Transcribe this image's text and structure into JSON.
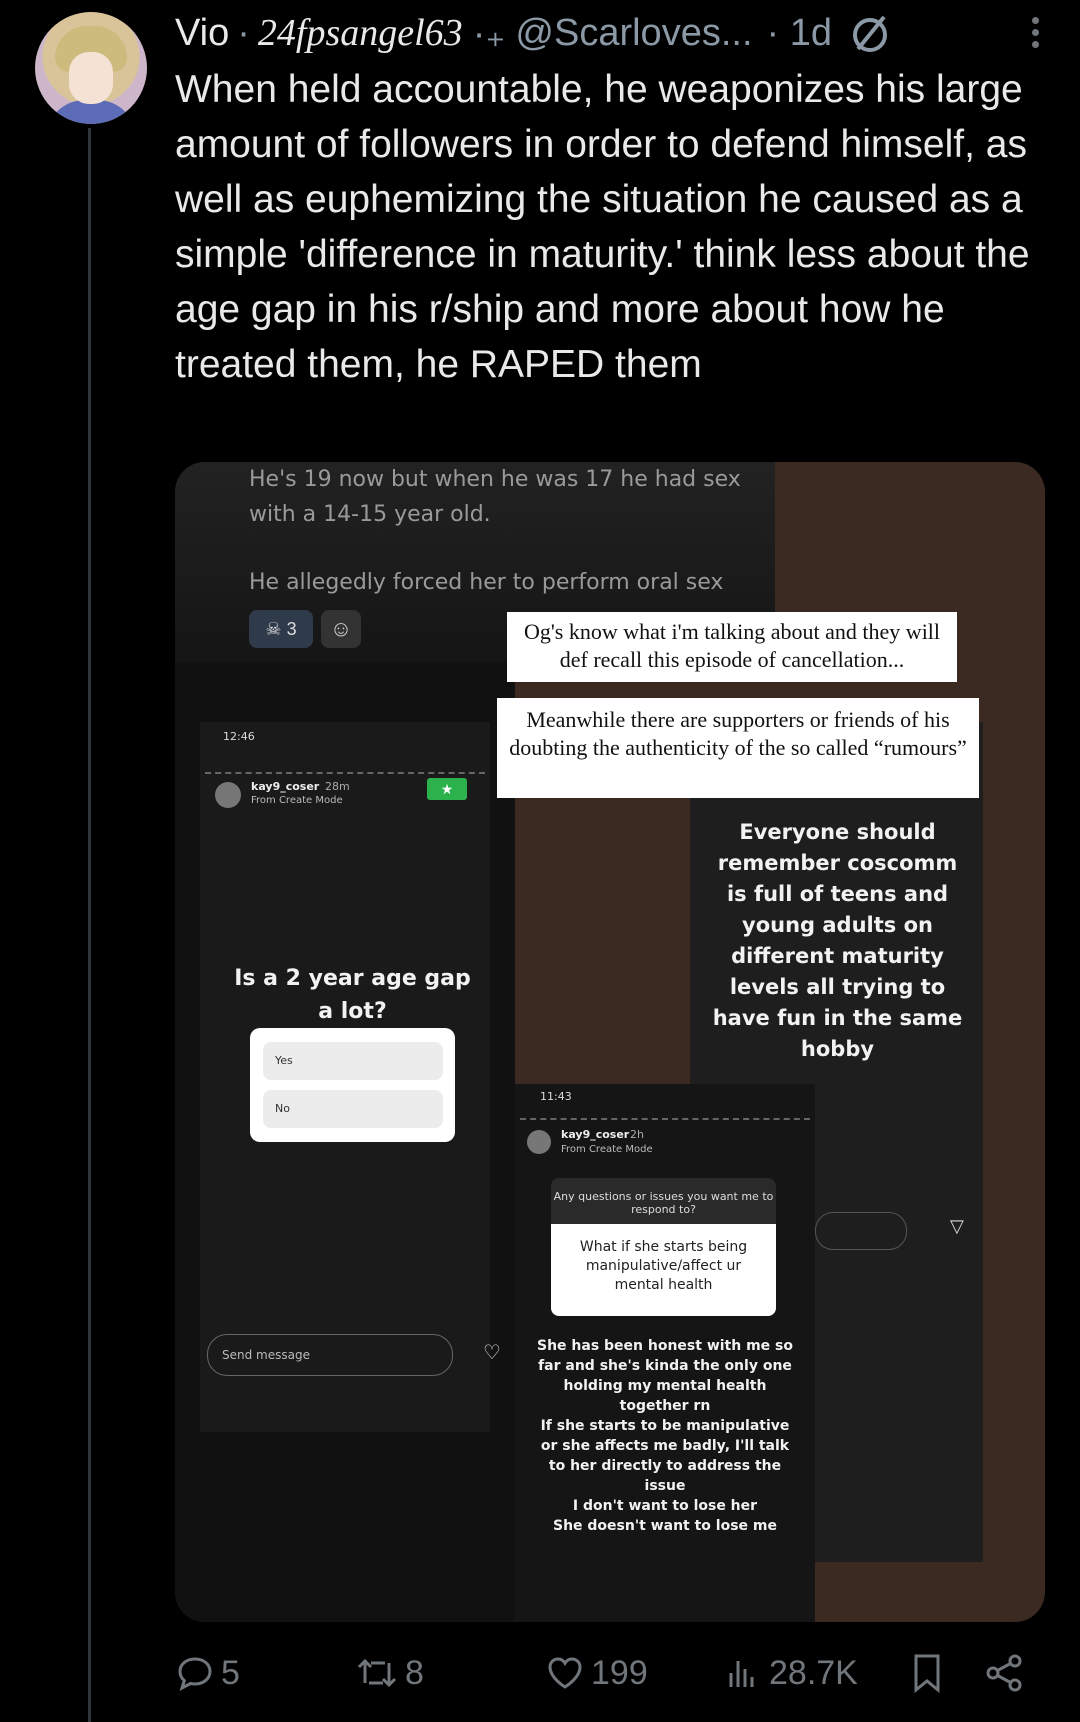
{
  "author": {
    "display_name": "Vio",
    "decor": "·",
    "fancy_name": "24fpsangel63",
    "decor2": "·₊",
    "handle": "@Scarloves...",
    "time": "· 1d"
  },
  "tweet": {
    "text": "When held accountable, he weaponizes his large amount of followers in order to defend himself, as well as euphemizing the situation he caused as a simple 'difference in maturity.' think less about the age gap in his r/ship and more about how he treated them, he RAPED them"
  },
  "media": {
    "comment_lines": [
      "He's 19 now but when he was 17 he had sex",
      "with a 14-15 year old.",
      "He allegedly forced her to perform oral sex"
    ],
    "reaction_count": "3",
    "caption1": "Og's know what i'm talking about and they will def recall this episode of cancellation...",
    "caption2": "Meanwhile there are supporters or friends of his doubting the authenticity of the so called “rumours”",
    "story1": {
      "time": "12:46",
      "user": "kay9_coser",
      "age": "28m",
      "mode": "From Create Mode",
      "question": "Is a 2 year age gap a lot?",
      "option_yes": "Yes",
      "option_no": "No",
      "send_placeholder": "Send message"
    },
    "story2_text": "Everyone should remember coscomm is full of teens and young adults on different maturity levels all trying to have fun in the same hobby",
    "story3": {
      "time": "11:43",
      "user": "kay9_coser",
      "age": "2h",
      "mode": "From Create Mode",
      "prompt": "Any questions or issues you want me to respond to?",
      "question": "What if she starts being manipulative/affect ur mental health",
      "answer_lines": [
        "She has been honest with me so",
        "far and she's kinda the only one",
        "holding my mental health",
        "together rn",
        "If she starts to be manipulative",
        "or she affects me badly, I'll talk",
        "to her directly to address the",
        "issue",
        "I don't want to lose her",
        "She doesn't want to lose me"
      ]
    }
  },
  "actions": {
    "replies": "5",
    "reposts": "8",
    "likes": "199",
    "views": "28.7K"
  },
  "icons": [
    "more-icon",
    "reply-icon",
    "repost-icon",
    "like-icon",
    "views-icon",
    "bookmark-icon",
    "share-icon",
    "skull-icon",
    "smile-icon",
    "heart-icon",
    "send-icon"
  ]
}
